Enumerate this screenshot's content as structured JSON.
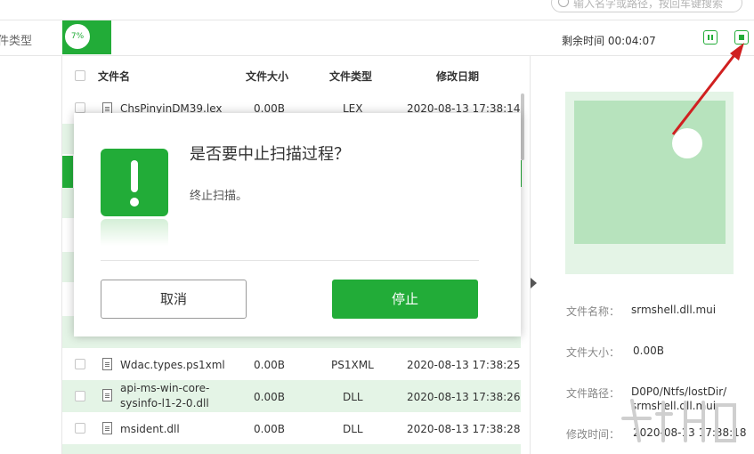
{
  "search": {
    "placeholder": "输入名字或路径，按回车键搜索"
  },
  "status": {
    "left_label": "件类型",
    "progress": "7%",
    "remaining": "剩余时间 00:04:07"
  },
  "table": {
    "headers": {
      "name": "文件名",
      "size": "文件大小",
      "type": "文件类型",
      "date": "修改日期"
    },
    "rows": [
      {
        "name": "ChsPinyinDM39.lex",
        "size": "0.00B",
        "type": "LEX",
        "date": "2020-08-13 17:38:14"
      },
      {
        "name": "Wdac.types.ps1xml",
        "size": "0.00B",
        "type": "PS1XML",
        "date": "2020-08-13 17:38:25"
      },
      {
        "name_line1": "api-ms-win-core-",
        "name_line2": "sysinfo-l1-2-0.dll",
        "size": "0.00B",
        "type": "DLL",
        "date": "2020-08-13 17:38:26"
      },
      {
        "name": "msident.dll",
        "size": "0.00B",
        "type": "DLL",
        "date": "2020-08-13 17:38:28"
      }
    ]
  },
  "preview": {
    "name_label": "文件名称：",
    "name_value": "srmshell.dll.mui",
    "size_label": "文件大小：",
    "size_value": "0.00B",
    "path_label": "文件路径：",
    "path_value_line1": "D0P0/Ntfs/lostDir/",
    "path_value_line2": "srmshell.dll.mui",
    "date_label": "修改时间：",
    "date_value": "2020-08-13 17:38:18"
  },
  "dialog": {
    "title": "是否要中止扫描过程？",
    "message": "终止扫描。",
    "cancel_label": "取消",
    "stop_label": "停止"
  },
  "colors": {
    "accent": "#22ac38",
    "row_highlight": "#e4f4e6",
    "arrow": "#d02020"
  }
}
